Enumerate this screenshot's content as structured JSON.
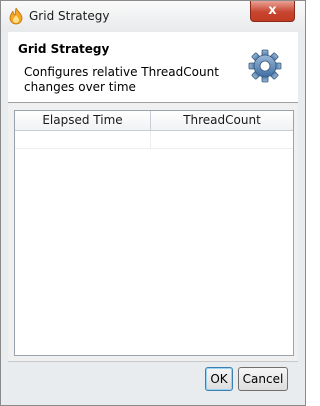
{
  "window": {
    "title": "Grid Strategy",
    "close_label": "x"
  },
  "header": {
    "title": "Grid Strategy",
    "description": "Configures relative ThreadCount changes over time",
    "icon": "gear-icon"
  },
  "table": {
    "columns": [
      "Elapsed Time",
      "ThreadCount"
    ],
    "rows": [
      [
        "",
        ""
      ]
    ]
  },
  "buttons": {
    "ok_label": "OK",
    "cancel_label": "Cancel"
  },
  "colors": {
    "close_button": "#c8452f",
    "gear": "#4a7fb5",
    "app_icon": "#f5a623"
  }
}
